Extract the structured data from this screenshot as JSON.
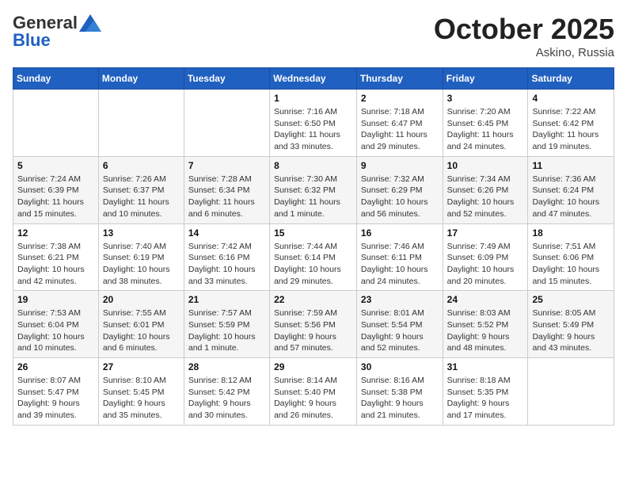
{
  "header": {
    "logo_general": "General",
    "logo_blue": "Blue",
    "month_title": "October 2025",
    "location": "Askino, Russia"
  },
  "weekdays": [
    "Sunday",
    "Monday",
    "Tuesday",
    "Wednesday",
    "Thursday",
    "Friday",
    "Saturday"
  ],
  "weeks": [
    [
      {
        "day": "",
        "info": ""
      },
      {
        "day": "",
        "info": ""
      },
      {
        "day": "",
        "info": ""
      },
      {
        "day": "1",
        "info": "Sunrise: 7:16 AM\nSunset: 6:50 PM\nDaylight: 11 hours and 33 minutes."
      },
      {
        "day": "2",
        "info": "Sunrise: 7:18 AM\nSunset: 6:47 PM\nDaylight: 11 hours and 29 minutes."
      },
      {
        "day": "3",
        "info": "Sunrise: 7:20 AM\nSunset: 6:45 PM\nDaylight: 11 hours and 24 minutes."
      },
      {
        "day": "4",
        "info": "Sunrise: 7:22 AM\nSunset: 6:42 PM\nDaylight: 11 hours and 19 minutes."
      }
    ],
    [
      {
        "day": "5",
        "info": "Sunrise: 7:24 AM\nSunset: 6:39 PM\nDaylight: 11 hours and 15 minutes."
      },
      {
        "day": "6",
        "info": "Sunrise: 7:26 AM\nSunset: 6:37 PM\nDaylight: 11 hours and 10 minutes."
      },
      {
        "day": "7",
        "info": "Sunrise: 7:28 AM\nSunset: 6:34 PM\nDaylight: 11 hours and 6 minutes."
      },
      {
        "day": "8",
        "info": "Sunrise: 7:30 AM\nSunset: 6:32 PM\nDaylight: 11 hours and 1 minute."
      },
      {
        "day": "9",
        "info": "Sunrise: 7:32 AM\nSunset: 6:29 PM\nDaylight: 10 hours and 56 minutes."
      },
      {
        "day": "10",
        "info": "Sunrise: 7:34 AM\nSunset: 6:26 PM\nDaylight: 10 hours and 52 minutes."
      },
      {
        "day": "11",
        "info": "Sunrise: 7:36 AM\nSunset: 6:24 PM\nDaylight: 10 hours and 47 minutes."
      }
    ],
    [
      {
        "day": "12",
        "info": "Sunrise: 7:38 AM\nSunset: 6:21 PM\nDaylight: 10 hours and 42 minutes."
      },
      {
        "day": "13",
        "info": "Sunrise: 7:40 AM\nSunset: 6:19 PM\nDaylight: 10 hours and 38 minutes."
      },
      {
        "day": "14",
        "info": "Sunrise: 7:42 AM\nSunset: 6:16 PM\nDaylight: 10 hours and 33 minutes."
      },
      {
        "day": "15",
        "info": "Sunrise: 7:44 AM\nSunset: 6:14 PM\nDaylight: 10 hours and 29 minutes."
      },
      {
        "day": "16",
        "info": "Sunrise: 7:46 AM\nSunset: 6:11 PM\nDaylight: 10 hours and 24 minutes."
      },
      {
        "day": "17",
        "info": "Sunrise: 7:49 AM\nSunset: 6:09 PM\nDaylight: 10 hours and 20 minutes."
      },
      {
        "day": "18",
        "info": "Sunrise: 7:51 AM\nSunset: 6:06 PM\nDaylight: 10 hours and 15 minutes."
      }
    ],
    [
      {
        "day": "19",
        "info": "Sunrise: 7:53 AM\nSunset: 6:04 PM\nDaylight: 10 hours and 10 minutes."
      },
      {
        "day": "20",
        "info": "Sunrise: 7:55 AM\nSunset: 6:01 PM\nDaylight: 10 hours and 6 minutes."
      },
      {
        "day": "21",
        "info": "Sunrise: 7:57 AM\nSunset: 5:59 PM\nDaylight: 10 hours and 1 minute."
      },
      {
        "day": "22",
        "info": "Sunrise: 7:59 AM\nSunset: 5:56 PM\nDaylight: 9 hours and 57 minutes."
      },
      {
        "day": "23",
        "info": "Sunrise: 8:01 AM\nSunset: 5:54 PM\nDaylight: 9 hours and 52 minutes."
      },
      {
        "day": "24",
        "info": "Sunrise: 8:03 AM\nSunset: 5:52 PM\nDaylight: 9 hours and 48 minutes."
      },
      {
        "day": "25",
        "info": "Sunrise: 8:05 AM\nSunset: 5:49 PM\nDaylight: 9 hours and 43 minutes."
      }
    ],
    [
      {
        "day": "26",
        "info": "Sunrise: 8:07 AM\nSunset: 5:47 PM\nDaylight: 9 hours and 39 minutes."
      },
      {
        "day": "27",
        "info": "Sunrise: 8:10 AM\nSunset: 5:45 PM\nDaylight: 9 hours and 35 minutes."
      },
      {
        "day": "28",
        "info": "Sunrise: 8:12 AM\nSunset: 5:42 PM\nDaylight: 9 hours and 30 minutes."
      },
      {
        "day": "29",
        "info": "Sunrise: 8:14 AM\nSunset: 5:40 PM\nDaylight: 9 hours and 26 minutes."
      },
      {
        "day": "30",
        "info": "Sunrise: 8:16 AM\nSunset: 5:38 PM\nDaylight: 9 hours and 21 minutes."
      },
      {
        "day": "31",
        "info": "Sunrise: 8:18 AM\nSunset: 5:35 PM\nDaylight: 9 hours and 17 minutes."
      },
      {
        "day": "",
        "info": ""
      }
    ]
  ]
}
